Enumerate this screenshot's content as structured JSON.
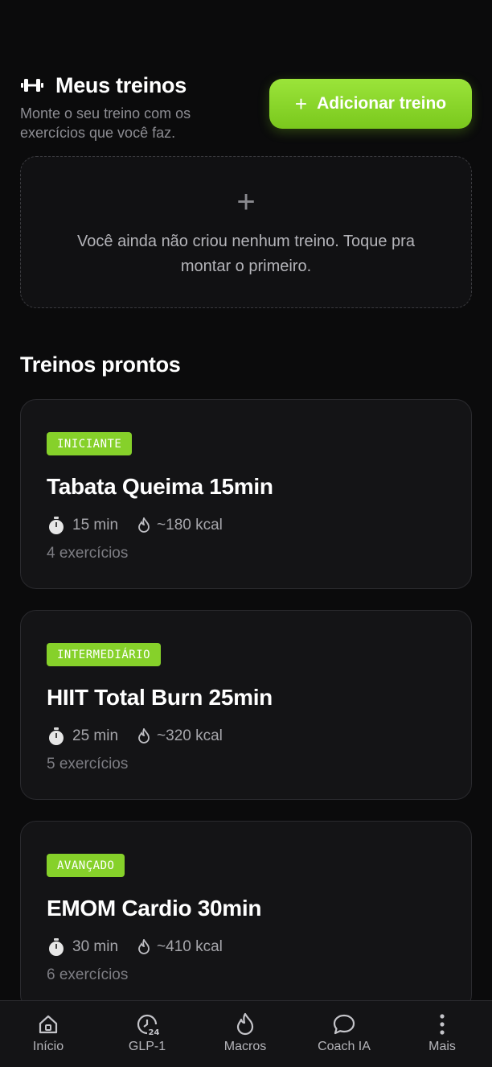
{
  "header": {
    "title": "Meus treinos",
    "subtitle": "Monte o seu treino com os exercícios que você faz.",
    "add_button_label": "Adicionar treino",
    "add_button_icon": "+"
  },
  "empty_state": {
    "icon": "+",
    "message": "Você ainda não criou nenhum treino. Toque pra montar o primeiro."
  },
  "ready_section": {
    "title": "Treinos prontos",
    "cards": [
      {
        "level": "INICIANTE",
        "title": "Tabata Queima 15min",
        "duration": "15 min",
        "calories": "~180 kcal",
        "exercises": "4 exercícios"
      },
      {
        "level": "INTERMEDIÁRIO",
        "title": "HIIT Total Burn 25min",
        "duration": "25 min",
        "calories": "~320 kcal",
        "exercises": "5 exercícios"
      },
      {
        "level": "AVANÇADO",
        "title": "EMOM Cardio 30min",
        "duration": "30 min",
        "calories": "~410 kcal",
        "exercises": "6 exercícios"
      }
    ]
  },
  "bottom_nav": {
    "items": [
      {
        "label": "Início",
        "icon": "home-icon"
      },
      {
        "label": "GLP-1",
        "icon": "clock-24-icon"
      },
      {
        "label": "Macros",
        "icon": "flame-icon"
      },
      {
        "label": "Coach IA",
        "icon": "chat-bubble-icon"
      },
      {
        "label": "Mais",
        "icon": "more-vertical-icon"
      }
    ]
  },
  "colors": {
    "background": "#0b0b0c",
    "accent": "#86d12a",
    "card": "#141416",
    "muted_text": "#8d8d93"
  }
}
